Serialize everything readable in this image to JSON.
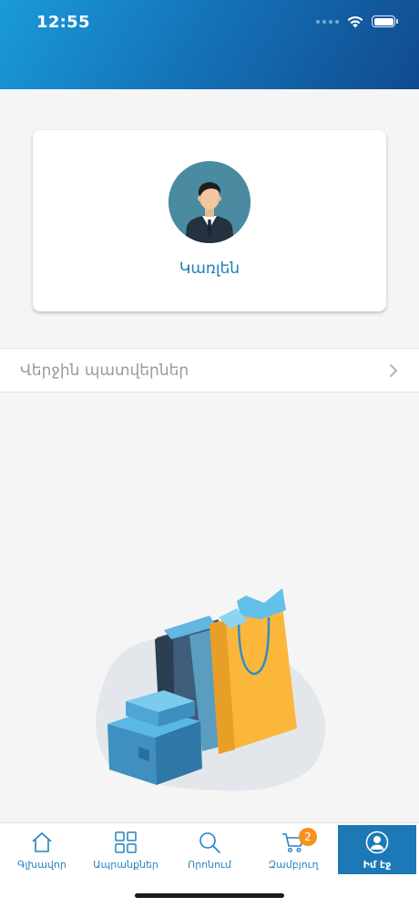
{
  "status_bar": {
    "time": "12:55"
  },
  "profile": {
    "name": "Կառլեն",
    "avatar_icon": "person-avatar-icon"
  },
  "recent_orders": {
    "label": "Վերջին պատվերներ",
    "icon": "chevron-right-icon"
  },
  "illustration": {
    "icon": "shopping-bags-boxes-illustration"
  },
  "tab_bar": {
    "items": [
      {
        "label": "Գլխավոր",
        "icon": "home-icon",
        "active": false
      },
      {
        "label": "Ապրանքներ",
        "icon": "grid-icon",
        "active": false
      },
      {
        "label": "Որոնում",
        "icon": "search-icon",
        "active": false
      },
      {
        "label": "Զամբյուղ",
        "icon": "cart-icon",
        "active": false,
        "badge": "2"
      },
      {
        "label": "Իմ էջ",
        "icon": "user-circle-icon",
        "active": true
      }
    ]
  },
  "colors": {
    "accent": "#1e7fb8",
    "header_start": "#1a9bd9",
    "header_end": "#114a8e",
    "badge": "#f6921e",
    "active_tab": "#1d78b6"
  }
}
